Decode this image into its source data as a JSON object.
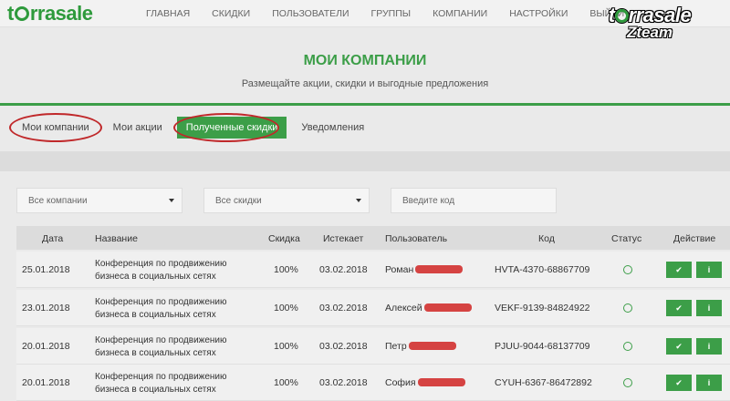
{
  "brand": {
    "logo_pre": "t",
    "logo_post": "rrasale"
  },
  "nav": [
    "ГЛАВНАЯ",
    "СКИДКИ",
    "ПОЛЬЗОВАТЕЛИ",
    "ГРУППЫ",
    "КОМПАНИИ",
    "НАСТРОЙКИ",
    "ВЫЙТИ"
  ],
  "watermark": {
    "logo_pre": "t",
    "logo_post": "rrasale",
    "sub": "Zteam"
  },
  "header": {
    "title": "МОИ КОМПАНИИ",
    "subtitle": "Размещайте акции, скидки и выгодные предложения"
  },
  "tabs": [
    {
      "label": "Мои компании",
      "active": false
    },
    {
      "label": "Мои акции",
      "active": false
    },
    {
      "label": "Полученные скидки",
      "active": true
    },
    {
      "label": "Уведомления",
      "active": false
    }
  ],
  "filters": {
    "companies": "Все компании",
    "discounts": "Все скидки",
    "code_placeholder": "Введите код"
  },
  "table": {
    "columns": [
      "Дата",
      "Название",
      "Скидка",
      "Истекает",
      "Пользователь",
      "Код",
      "Статус",
      "Действие"
    ],
    "rows": [
      {
        "date": "25.01.2018",
        "name": "Конференция по продвижению бизнеса в социальных сетях",
        "discount": "100%",
        "expires": "03.02.2018",
        "user": "Роман",
        "code": "HVTA-4370-68867709"
      },
      {
        "date": "23.01.2018",
        "name": "Конференция по продвижению бизнеса в социальных сетях",
        "discount": "100%",
        "expires": "03.02.2018",
        "user": "Алексей",
        "code": "VEKF-9139-84824922"
      },
      {
        "date": "20.01.2018",
        "name": "Конференция по продвижению бизнеса в социальных сетях",
        "discount": "100%",
        "expires": "03.02.2018",
        "user": "Петр",
        "code": "PJUU-9044-68137709"
      },
      {
        "date": "20.01.2018",
        "name": "Конференция по продвижению бизнеса в социальных сетях",
        "discount": "100%",
        "expires": "03.02.2018",
        "user": "София",
        "code": "CYUH-6367-86472892"
      }
    ],
    "check_symbol": "✔",
    "info_symbol": "i"
  },
  "colors": {
    "accent": "#3c9e48",
    "annotation": "#c0282a"
  }
}
